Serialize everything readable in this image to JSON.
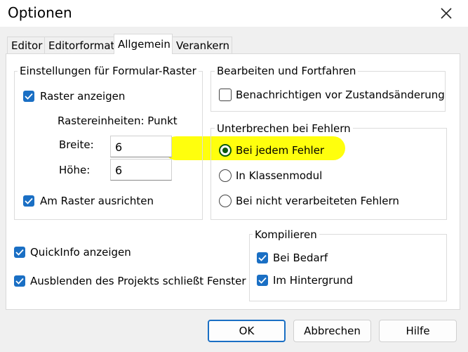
{
  "window": {
    "title": "Optionen",
    "close_icon": "close-icon"
  },
  "tabs": [
    {
      "label": "Editor"
    },
    {
      "label": "Editorformat"
    },
    {
      "label": "Allgemein",
      "active": true
    },
    {
      "label": "Verankern"
    }
  ],
  "grid_group": {
    "title": "Einstellungen für Formular-Raster",
    "show_grid": {
      "label": "Raster anzeigen",
      "checked": true
    },
    "units": "Rastereinheiten: Punkt",
    "width_label": "Breite:",
    "width_value": "6",
    "height_label": "Höhe:",
    "height_value": "6",
    "align": {
      "label": "Am Raster ausrichten",
      "checked": true
    }
  },
  "edit_group": {
    "title": "Bearbeiten und Fortfahren",
    "notify": {
      "label": "Benachrichtigen vor Zustandsänderung",
      "checked": false
    }
  },
  "error_group": {
    "title": "Unterbrechen bei Fehlern",
    "options": [
      {
        "label": "Bei jedem Fehler",
        "selected": true
      },
      {
        "label": "In Klassenmodul",
        "selected": false
      },
      {
        "label": "Bei nicht verarbeiteten Fehlern",
        "selected": false
      }
    ]
  },
  "misc": {
    "quickinfo": {
      "label": "QuickInfo anzeigen",
      "checked": true
    },
    "hide_project": {
      "label": "Ausblenden des Projekts schließt Fenster",
      "checked": true
    }
  },
  "compile_group": {
    "title": "Kompilieren",
    "on_demand": {
      "label": "Bei Bedarf",
      "checked": true
    },
    "background": {
      "label": "Im Hintergrund",
      "checked": true
    }
  },
  "buttons": {
    "ok": "OK",
    "cancel": "Abbrechen",
    "help": "Hilfe"
  },
  "colors": {
    "accent": "#1a6fc4",
    "highlight": "#ffff00",
    "radio_selected": "#0b5a0b"
  }
}
